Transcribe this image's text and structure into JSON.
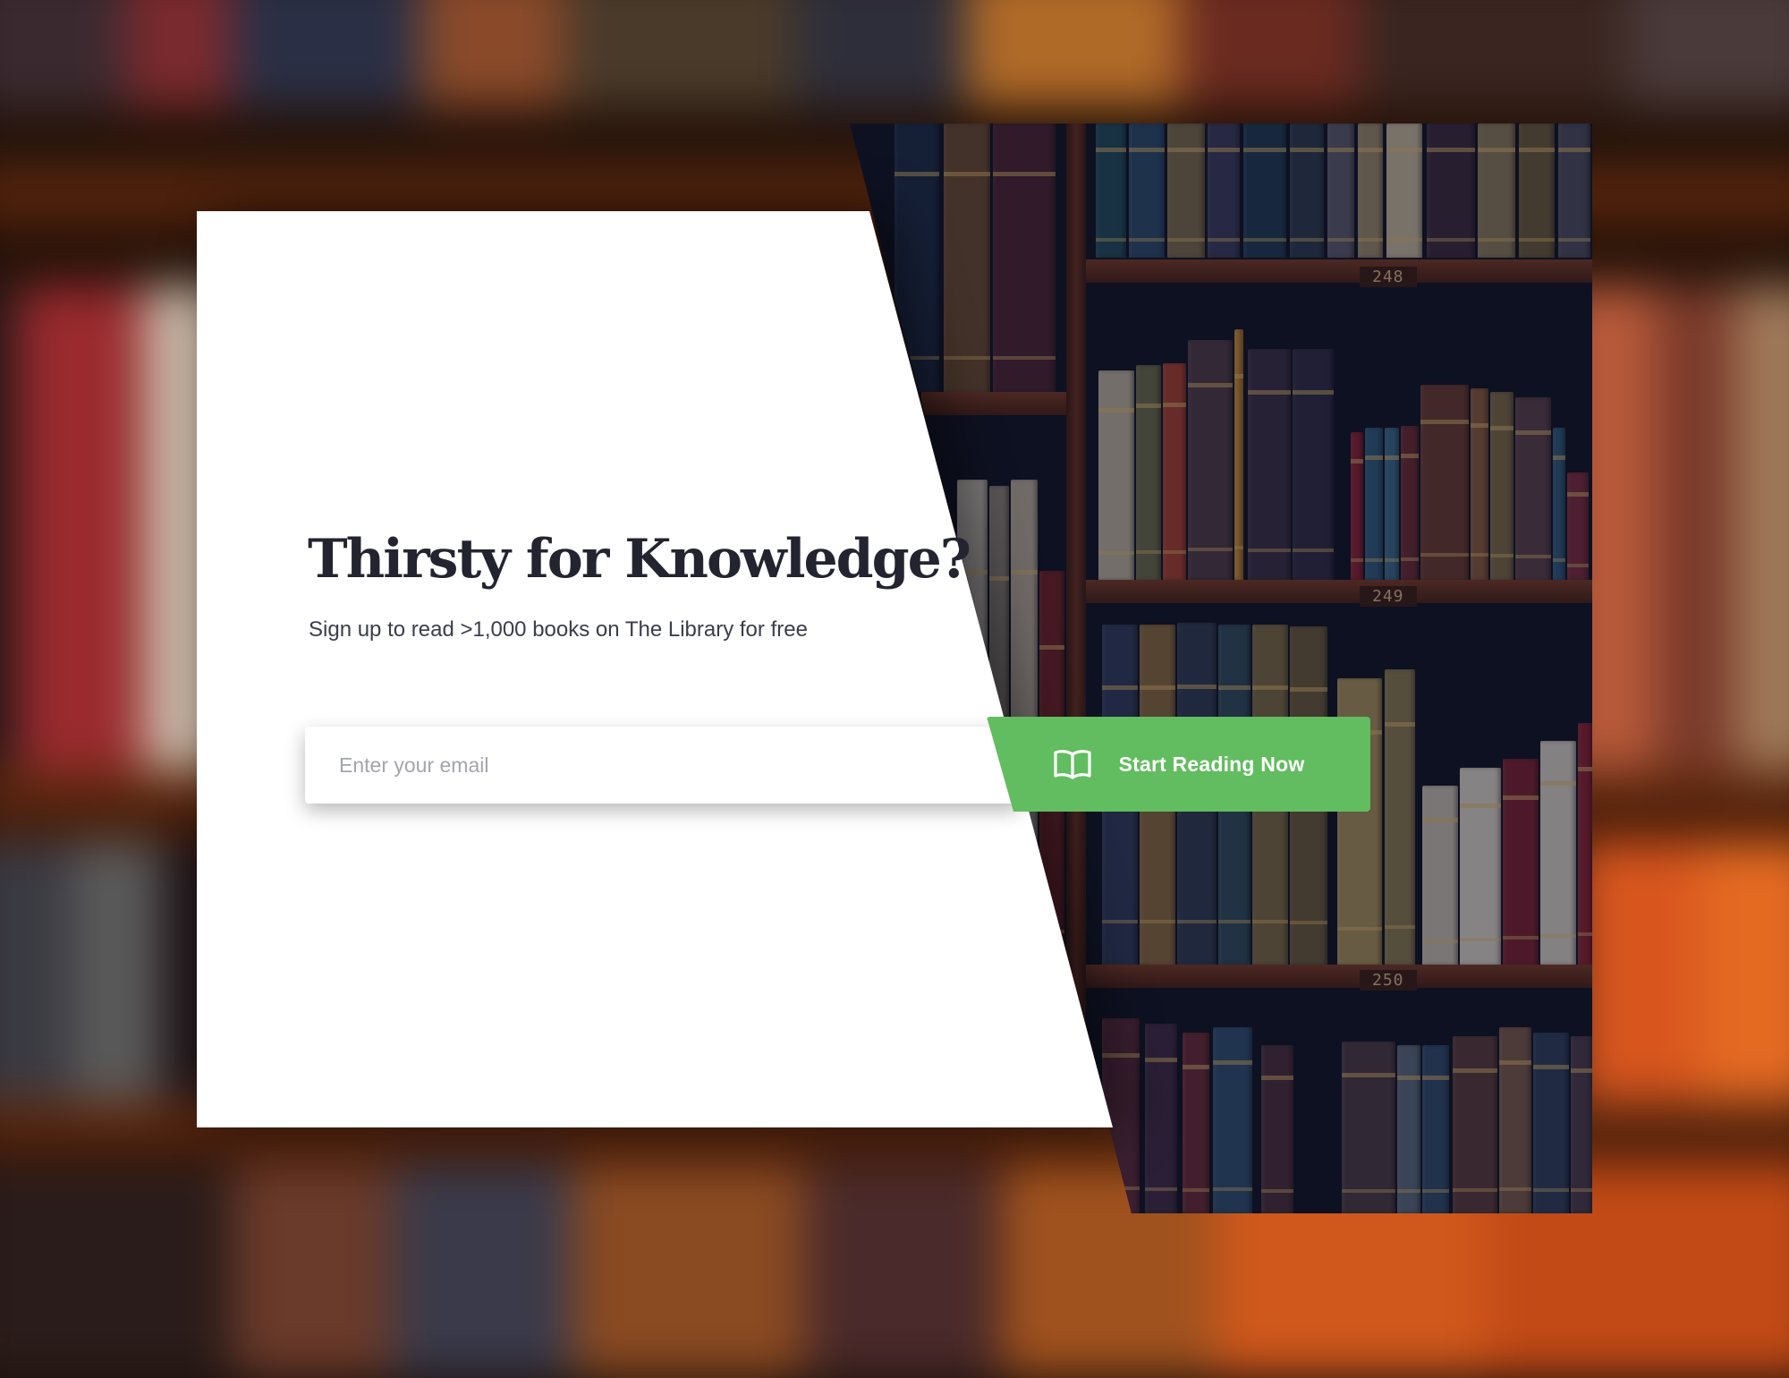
{
  "hero": {
    "title": "Thirsty for Knowledge?",
    "subtitle": "Sign up to read >1,000 books on The Library for free"
  },
  "signup": {
    "email_placeholder": "Enter your email",
    "cta_label": "Start Reading Now",
    "cta_icon": "open-book-icon",
    "cta_color": "#61bd5f"
  },
  "image": {
    "shelf_numbers": [
      "248",
      "249",
      "250"
    ]
  },
  "colors": {
    "title": "#23242f",
    "subtitle": "#3b3d4a",
    "card": "#ffffff"
  }
}
